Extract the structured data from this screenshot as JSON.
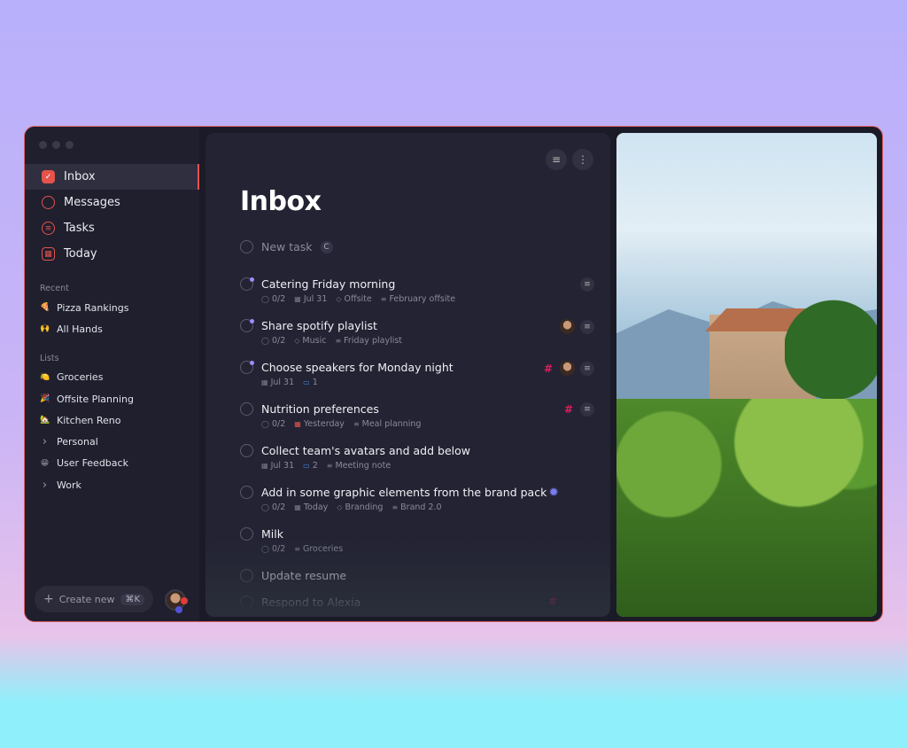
{
  "sidebar": {
    "nav": [
      {
        "label": "Inbox",
        "icon": "inbox-check-icon"
      },
      {
        "label": "Messages",
        "icon": "messages-icon"
      },
      {
        "label": "Tasks",
        "icon": "tasks-icon"
      },
      {
        "label": "Today",
        "icon": "calendar-icon"
      }
    ],
    "recent_label": "Recent",
    "recent": [
      {
        "label": "Pizza Rankings",
        "emoji": "🍕"
      },
      {
        "label": "All Hands",
        "emoji": "🙌"
      }
    ],
    "lists_label": "Lists",
    "lists": [
      {
        "label": "Groceries",
        "emoji": "🍋"
      },
      {
        "label": "Offsite Planning",
        "emoji": "🎉"
      },
      {
        "label": "Kitchen Reno",
        "emoji": "🏡"
      },
      {
        "label": "Personal",
        "emoji": "›"
      },
      {
        "label": "User Feedback",
        "emoji": "😁"
      },
      {
        "label": "Work",
        "emoji": "›"
      }
    ],
    "create_label": "Create new",
    "create_shortcut": "⌘K"
  },
  "main": {
    "title": "Inbox",
    "new_task": "New task",
    "new_task_shortcut": "C",
    "tasks": [
      {
        "title": "Catering Friday morning",
        "meta": [
          "0/2",
          "Jul 31",
          "Offsite",
          "February offsite"
        ]
      },
      {
        "title": "Share spotify playlist",
        "meta": [
          "0/2",
          "Music",
          "Friday playlist"
        ]
      },
      {
        "title": "Choose speakers for Monday night",
        "meta": [
          "Jul 31",
          "1"
        ]
      },
      {
        "title": "Nutrition preferences",
        "meta": [
          "0/2",
          "Yesterday",
          "Meal planning"
        ]
      },
      {
        "title": "Collect team's avatars and add below",
        "meta": [
          "Jul 31",
          "2",
          "Meeting note"
        ]
      },
      {
        "title": "Add in some graphic elements from the brand pack",
        "meta": [
          "0/2",
          "Today",
          "Branding",
          "Brand 2.0"
        ]
      },
      {
        "title": "Milk",
        "meta": [
          "0/2",
          "Groceries"
        ]
      },
      {
        "title": "Update resume",
        "meta": []
      },
      {
        "title": "Respond to Alexia",
        "meta": []
      }
    ]
  },
  "colors": {
    "accent": "#e5534b",
    "unread_dot": "#9d8cff"
  }
}
